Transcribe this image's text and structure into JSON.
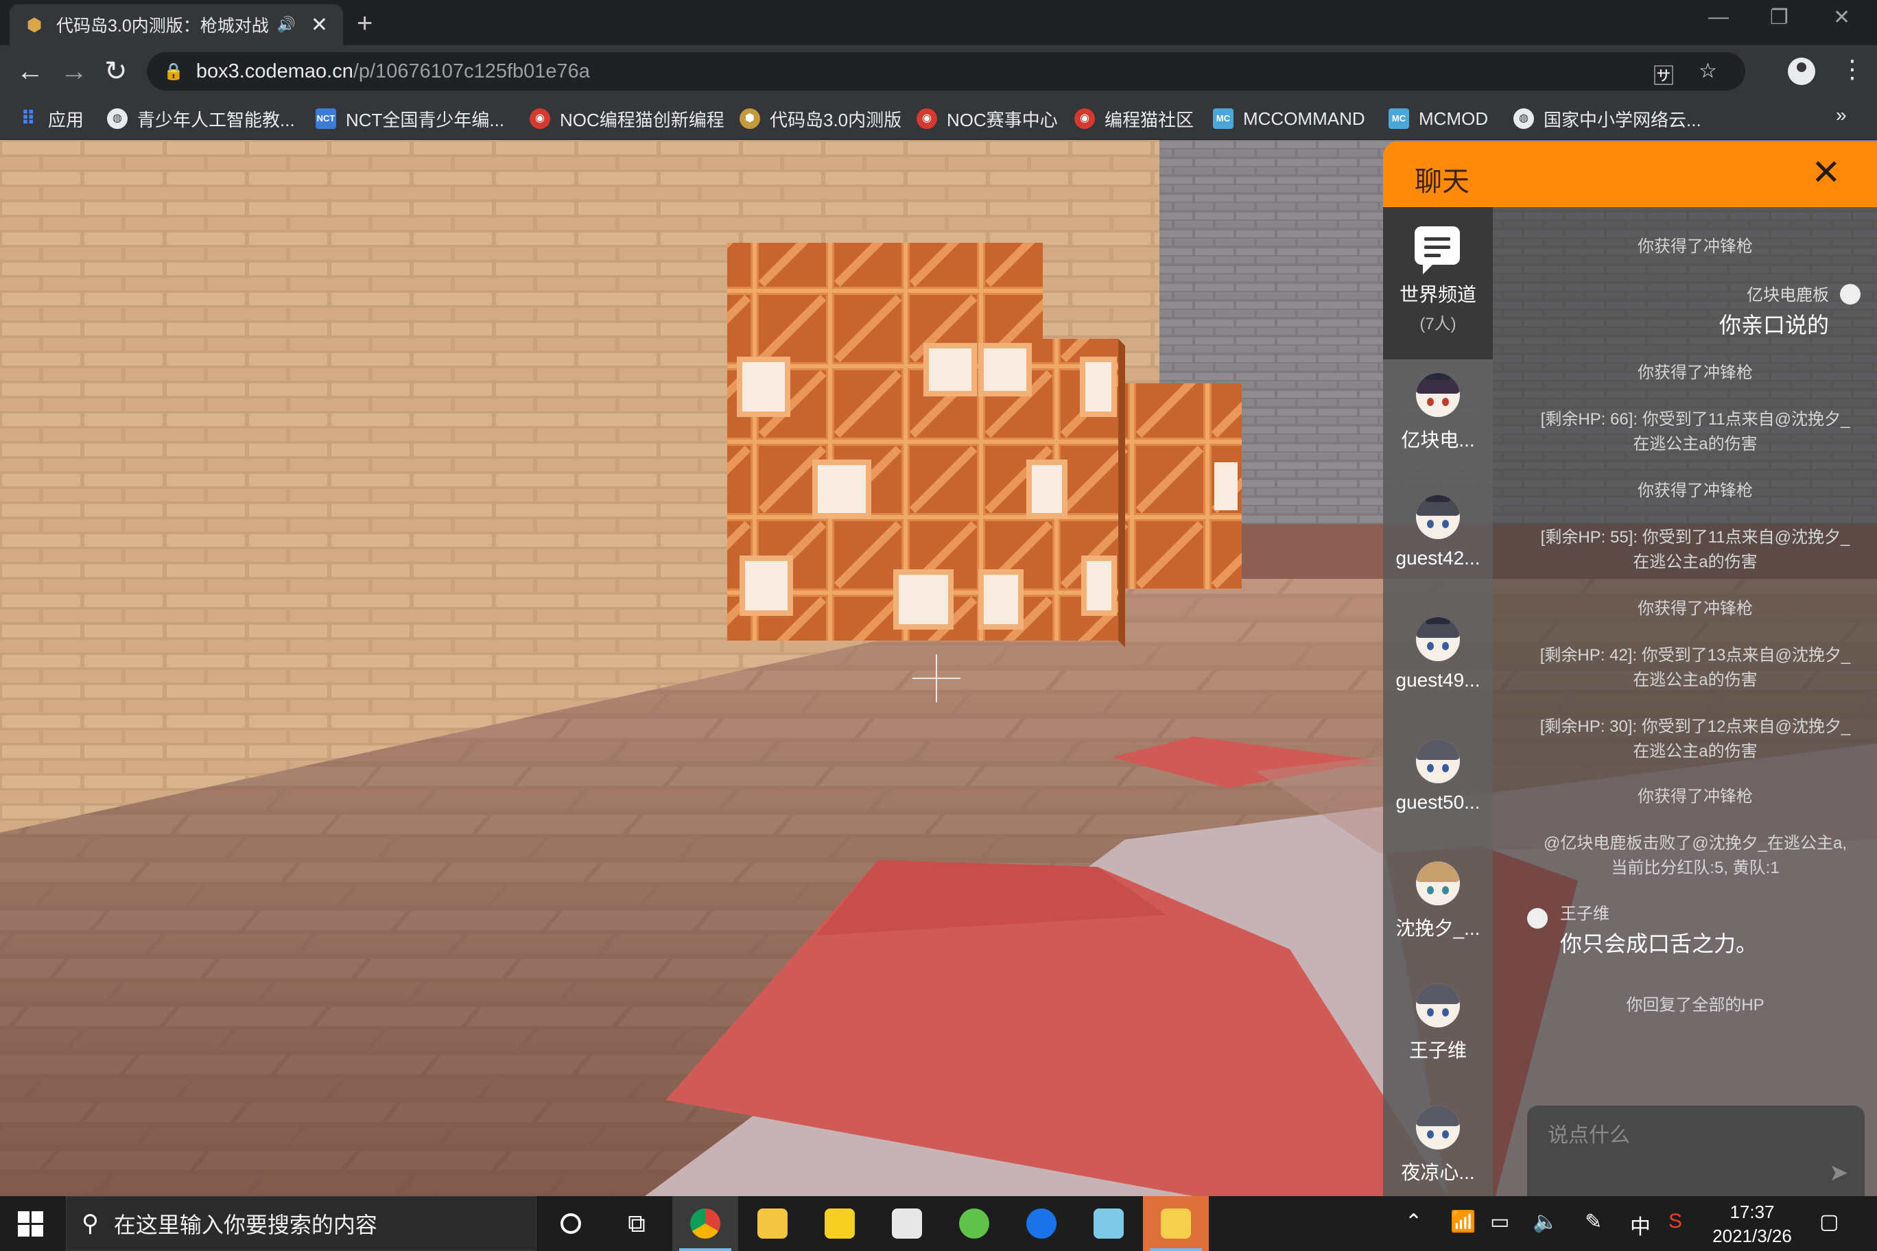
{
  "browser": {
    "tab_title": "代码岛3.0内测版：枪城对战",
    "new_tab": "+",
    "url_host": "box3.codemao.cn",
    "url_path": "/p/10676107c125fb01e76a"
  },
  "bookmarks": [
    {
      "label": "应用",
      "icon": "apps-grid-icon"
    },
    {
      "label": "青少年人工智能教...",
      "icon": "globe-icon"
    },
    {
      "label": "NCT全国青少年编...",
      "icon": "nct-icon"
    },
    {
      "label": "NOC编程猫创新编程",
      "icon": "codemao-icon"
    },
    {
      "label": "代码岛3.0内测版",
      "icon": "box3-icon"
    },
    {
      "label": "NOC赛事中心",
      "icon": "codemao-icon"
    },
    {
      "label": "编程猫社区",
      "icon": "codemao-icon"
    },
    {
      "label": "MCCOMMAND",
      "icon": "mc-icon"
    },
    {
      "label": "MCMOD",
      "icon": "mc-icon"
    },
    {
      "label": "国家中小学网络云...",
      "icon": "globe-icon"
    }
  ],
  "chat": {
    "title": "聊天",
    "channel": {
      "name": "世界频道",
      "count": "(7人)"
    },
    "members": [
      "亿块电...",
      "guest42...",
      "guest49...",
      "guest50...",
      "沈挽夕_...",
      "王子维",
      "夜凉心..."
    ],
    "messages": [
      {
        "type": "system",
        "text": "你获得了冲锋枪"
      },
      {
        "type": "user",
        "user": "亿块电鹿板",
        "text": "你亲口说的"
      },
      {
        "type": "system",
        "text": "你获得了冲锋枪"
      },
      {
        "type": "system",
        "text": "[剩余HP: 66]: 你受到了11点来自@沈挽夕_在逃公主a的伤害"
      },
      {
        "type": "system",
        "text": "你获得了冲锋枪"
      },
      {
        "type": "system",
        "text": "[剩余HP: 55]: 你受到了11点来自@沈挽夕_在逃公主a的伤害"
      },
      {
        "type": "system",
        "text": "你获得了冲锋枪"
      },
      {
        "type": "system",
        "text": "[剩余HP: 42]: 你受到了13点来自@沈挽夕_在逃公主a的伤害"
      },
      {
        "type": "system",
        "text": "[剩余HP: 30]: 你受到了12点来自@沈挽夕_在逃公主a的伤害"
      },
      {
        "type": "system",
        "text": "你获得了冲锋枪"
      },
      {
        "type": "system",
        "text": "@亿块电鹿板击败了@沈挽夕_在逃公主a, 当前比分红队:5, 黄队:1"
      },
      {
        "type": "user",
        "user": "王子维",
        "text": "你只会成口舌之力。"
      },
      {
        "type": "system",
        "text": "你回复了全部的HP"
      }
    ],
    "input_placeholder": "说点什么"
  },
  "taskbar": {
    "search_placeholder": "在这里输入你要搜索的内容",
    "time": "17:37",
    "date": "2021/3/26",
    "ime": "中"
  },
  "colors": {
    "chat_header": "#ff8a0a",
    "brick": "#c9a27c",
    "floor_red": "#d05a55"
  }
}
